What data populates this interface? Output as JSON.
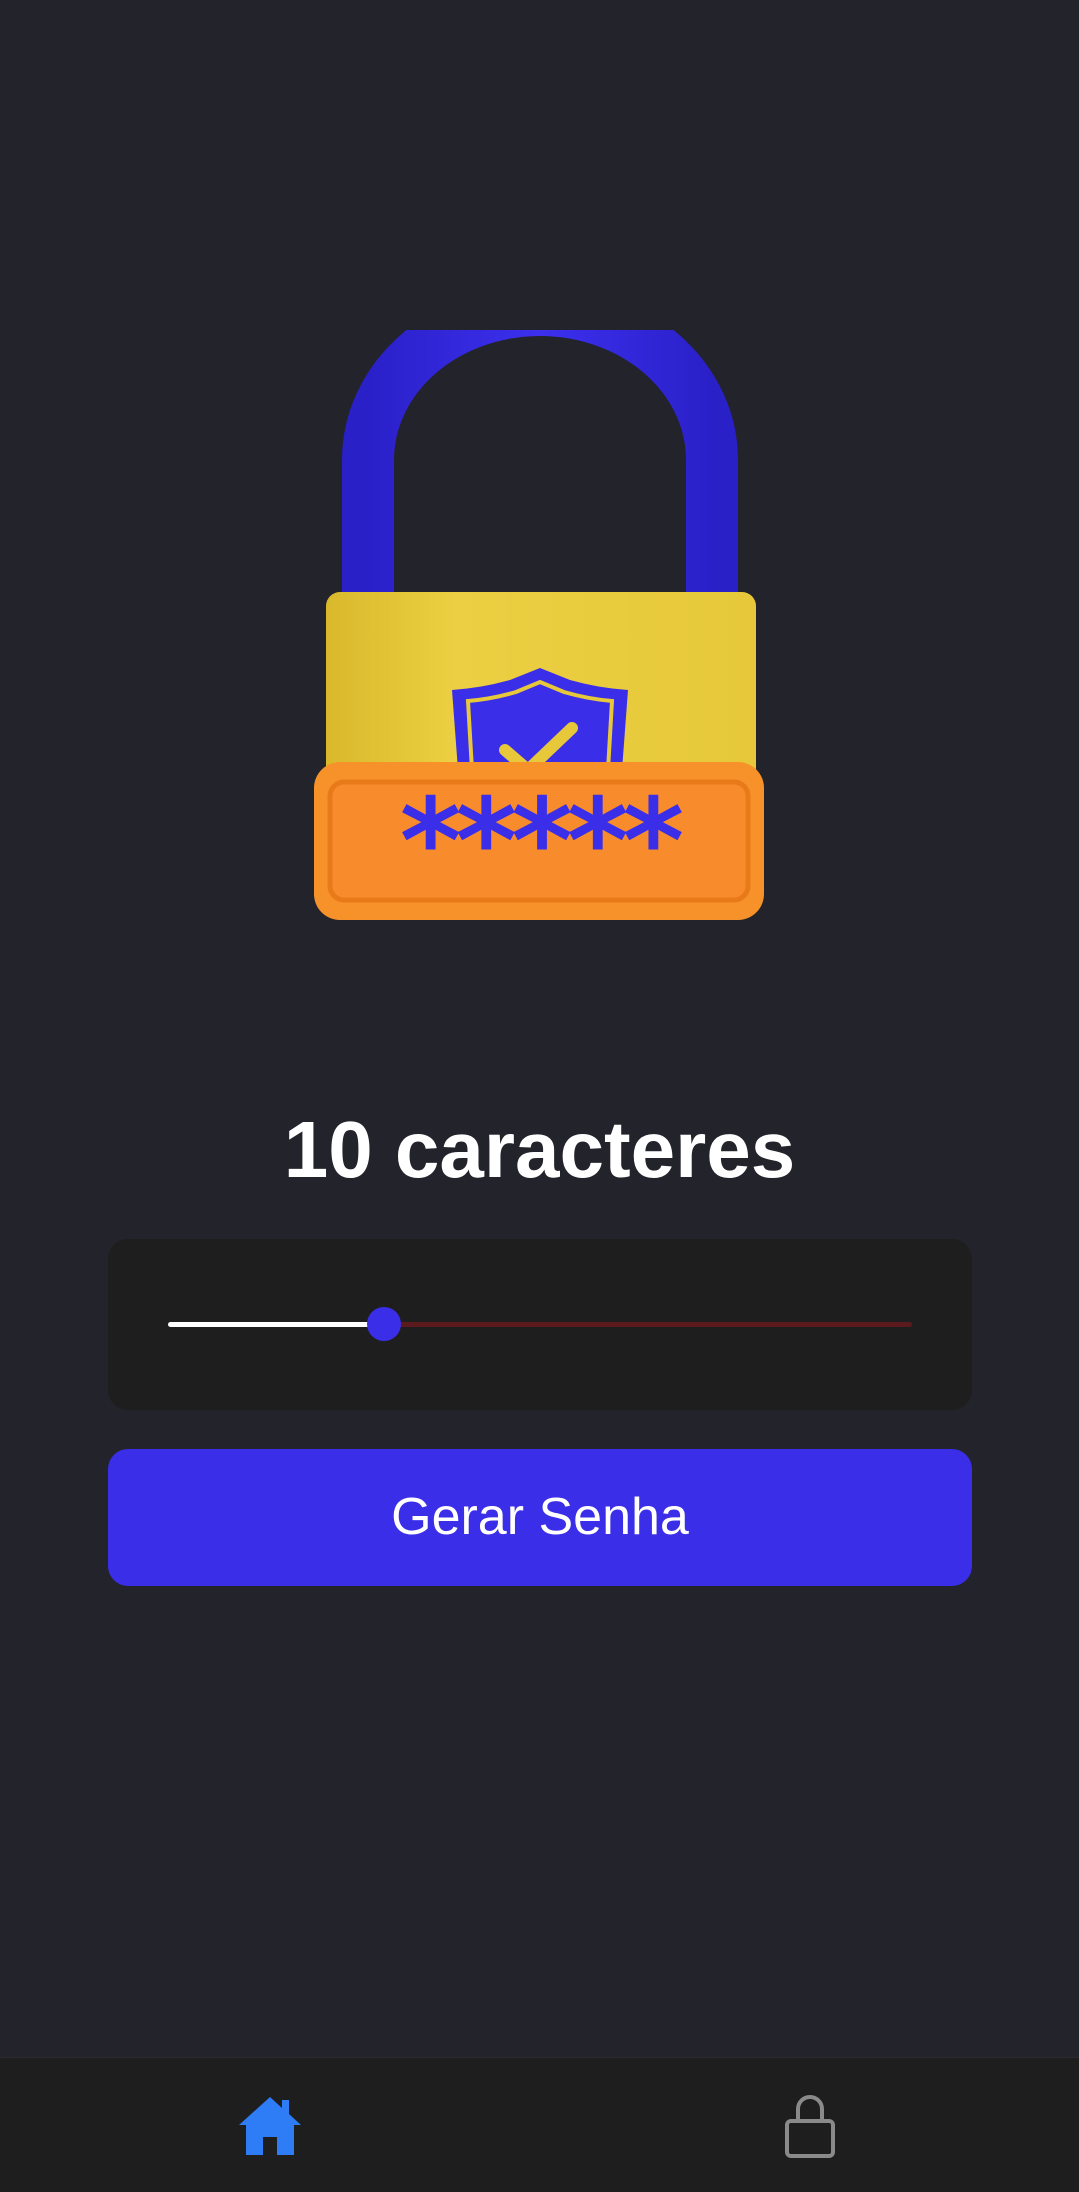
{
  "logo": {
    "icon": "padlock-with-password-icon",
    "masked_text": "*****",
    "colors": {
      "shackle": "#3a2ee8",
      "body": "#e8c93a",
      "plate": "#f5922e",
      "shield": "#3a2ee8"
    }
  },
  "main": {
    "title": "10 caracteres",
    "slider": {
      "value": 10,
      "fill_fraction": 0.29,
      "colors": {
        "active": "#ffffff",
        "inactive": "#5a1a1e",
        "thumb": "#3a2ee8"
      }
    },
    "generate_button": {
      "label": "Gerar Senha",
      "color": "#3a2ee8"
    }
  },
  "bottom_nav": {
    "items": [
      {
        "icon": "home-icon",
        "active": true,
        "color": "#2e7cf6"
      },
      {
        "icon": "lock-icon",
        "active": false,
        "color": "#8a8a8a"
      }
    ]
  }
}
